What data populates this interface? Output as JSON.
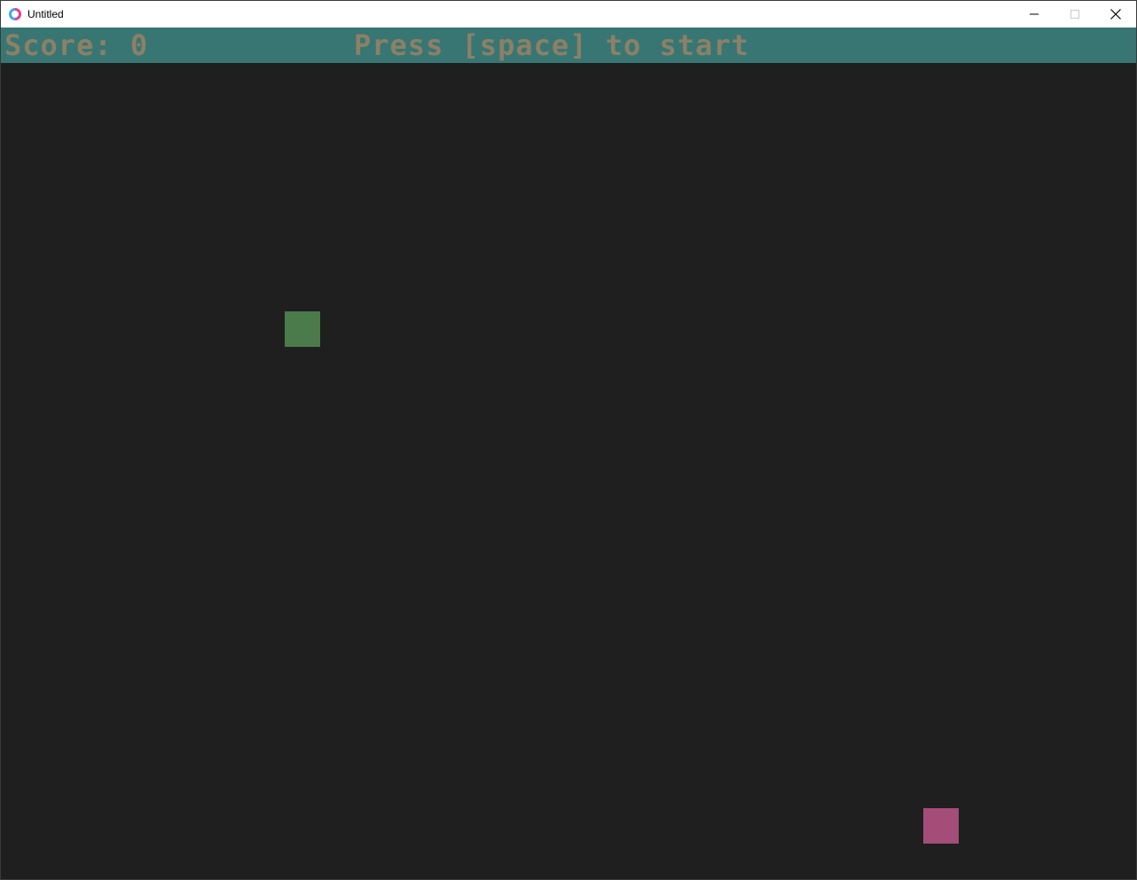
{
  "window": {
    "title": "Untitled",
    "controls": [
      "minimize-icon",
      "maximize-icon",
      "close-icon"
    ]
  },
  "hud": {
    "score_text": "Score: 0",
    "prompt_text": "Press [space] to start",
    "background_color": "#387673",
    "text_color": "#8c8066"
  },
  "game": {
    "background_color": "#1f1f1f",
    "snake_color": "#4b7a4b",
    "food_color": "#a34d78"
  }
}
